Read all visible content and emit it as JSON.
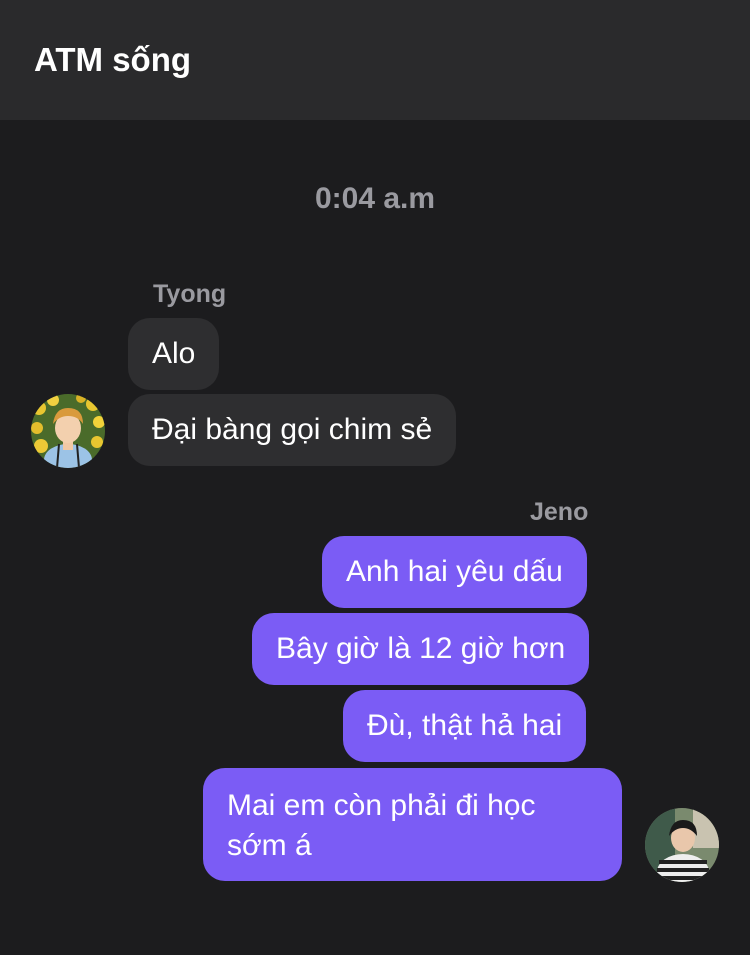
{
  "header": {
    "title": "ATM sống"
  },
  "conversation": {
    "timestamp": "0:04 a.m",
    "groups": [
      {
        "sender": "Tyong",
        "direction": "incoming",
        "messages": [
          "Alo",
          "Đại bàng gọi chim sẻ"
        ]
      },
      {
        "sender": "Jeno",
        "direction": "outgoing",
        "messages": [
          "Anh hai yêu dấu",
          "Bây giờ là 12 giờ hơn",
          "Đù, thật hả hai",
          "Mai em còn phải đi học sớm á"
        ]
      }
    ]
  },
  "colors": {
    "background": "#1c1c1e",
    "header": "#2a2a2c",
    "incoming_bubble": "#2e2e30",
    "outgoing_bubble": "#7b5cf5",
    "muted_text": "#9a9aa0"
  }
}
